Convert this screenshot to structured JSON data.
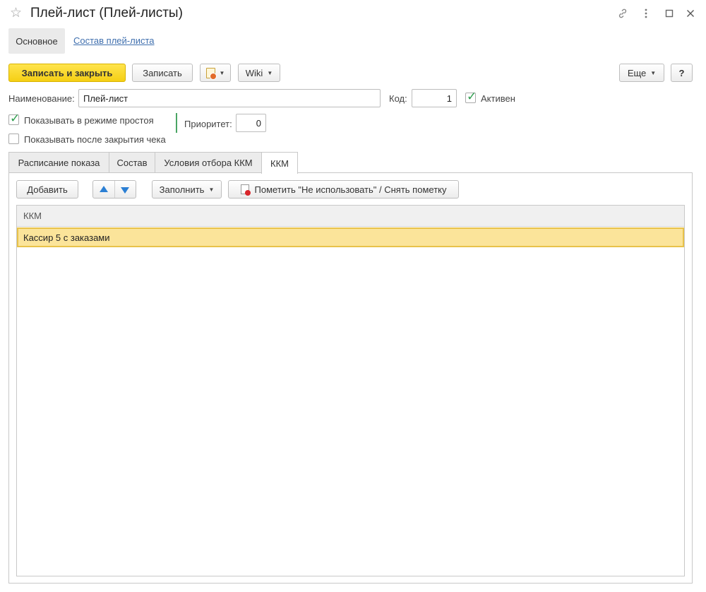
{
  "window": {
    "title": "Плей-лист (Плей-листы)",
    "star_icon": "star-icon",
    "link_icon": "link-icon",
    "more_icon": "more-vertical-icon",
    "maximize_icon": "maximize-icon",
    "close_icon": "close-icon"
  },
  "nav": {
    "main_tab": "Основное",
    "content_link": "Состав плей-листа"
  },
  "toolbar": {
    "save_close": "Записать и закрыть",
    "save": "Записать",
    "wiki": "Wiki",
    "more": "Еще",
    "help": "?"
  },
  "form": {
    "name_label": "Наименование:",
    "name_value": "Плей-лист",
    "code_label": "Код:",
    "code_value": "1",
    "active_label": "Активен",
    "active_checked": true,
    "idle_label": "Показывать в режиме простоя",
    "idle_checked": true,
    "after_check_label": "Показывать после закрытия чека",
    "after_check_checked": false,
    "priority_label": "Приоритет:",
    "priority_value": "0"
  },
  "tabs": [
    {
      "label": "Расписание показа"
    },
    {
      "label": "Состав"
    },
    {
      "label": "Условия отбора ККМ"
    },
    {
      "label": "ККМ",
      "active": true
    }
  ],
  "kkm_panel": {
    "add": "Добавить",
    "fill": "Заполнить",
    "mark": "Пометить \"Не использовать\" / Снять пометку",
    "table": {
      "columns": [
        "ККМ"
      ],
      "rows": [
        {
          "kkm": "Кассир 5 с заказами"
        }
      ]
    }
  },
  "colors": {
    "primary_button": "#f5cf14",
    "selected_row": "#fbe49a",
    "link": "#3f6fae",
    "check": "#2e9e4e"
  }
}
